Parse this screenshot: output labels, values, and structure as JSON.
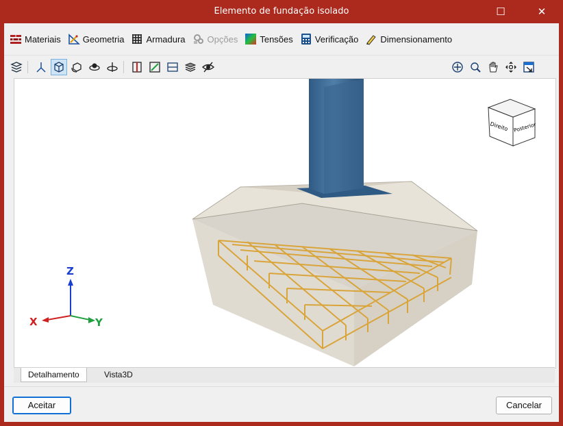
{
  "window": {
    "title": "Elemento de fundação isolado",
    "maximize_glyph": "☐",
    "close_glyph": "✕"
  },
  "menu": [
    {
      "label": "Materiais",
      "icon": "materials-icon",
      "enabled": true
    },
    {
      "label": "Geometria",
      "icon": "geometry-icon",
      "enabled": true
    },
    {
      "label": "Armadura",
      "icon": "reinforcement-icon",
      "enabled": true
    },
    {
      "label": "Opções",
      "icon": "options-icon",
      "enabled": false
    },
    {
      "label": "Tensões",
      "icon": "stresses-icon",
      "enabled": true
    },
    {
      "label": "Verificação",
      "icon": "verification-icon",
      "enabled": true
    },
    {
      "label": "Dimensionamento",
      "icon": "design-icon",
      "enabled": true
    }
  ],
  "toolbar": {
    "left_icons": [
      "layers-icon",
      "axes-icon",
      "solid-view-icon",
      "rotate-view-icon",
      "orbit-icon",
      "pivot-icon",
      "section-icon",
      "diagram-icon",
      "plane-icon",
      "layers-stack-icon",
      "visibility-icon"
    ],
    "right_icons": [
      "zoom-extents-icon",
      "zoom-window-icon",
      "pan-icon",
      "orbit-3d-icon",
      "fit-view-icon"
    ],
    "active_icon": "solid-view-icon"
  },
  "viewport": {
    "view_cube": {
      "left_face": "Direito",
      "front_face": "Posterior"
    },
    "axes": {
      "x": "X",
      "y": "Y",
      "z": "Z"
    },
    "colors": {
      "column": "#3d6a93",
      "concrete": "#d8d2c4",
      "rebar": "#d9a43a"
    }
  },
  "tabs": [
    {
      "label": "Detalhamento",
      "selected": true
    },
    {
      "label": "Vista3D",
      "selected": false
    }
  ],
  "buttons": {
    "accept": "Aceitar",
    "cancel": "Cancelar"
  }
}
